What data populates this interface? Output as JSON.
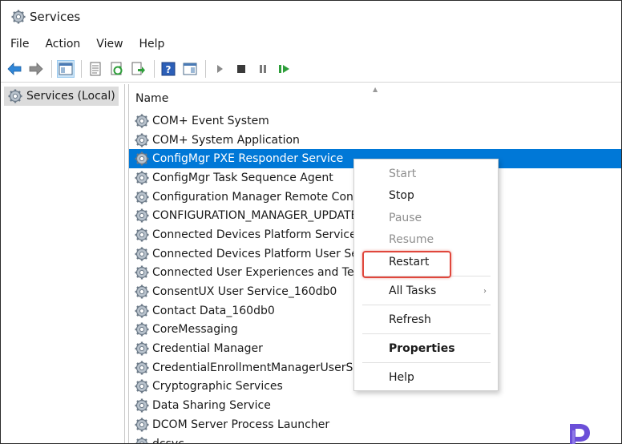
{
  "window": {
    "title": "Services"
  },
  "menu": [
    "File",
    "Action",
    "View",
    "Help"
  ],
  "tree": {
    "root_label": "Services (Local)"
  },
  "list": {
    "column_name": "Name",
    "rows": [
      "COM+ Event System",
      "COM+ System Application",
      "ConfigMgr PXE Responder Service",
      "ConfigMgr Task Sequence Agent",
      "Configuration Manager Remote Contro",
      "CONFIGURATION_MANAGER_UPDATE",
      "Connected Devices Platform Service",
      "Connected Devices Platform User Servic",
      "Connected User Experiences and Teleme",
      "ConsentUX User Service_160db0",
      "Contact Data_160db0",
      "CoreMessaging",
      "Credential Manager",
      "CredentialEnrollmentManagerUserSvc_",
      "Cryptographic Services",
      "Data Sharing Service",
      "DCOM Server Process Launcher",
      "dcsvc"
    ],
    "selected_index": 2
  },
  "context_menu": {
    "start": "Start",
    "stop": "Stop",
    "pause": "Pause",
    "resume": "Resume",
    "restart": "Restart",
    "all_tasks": "All Tasks",
    "refresh": "Refresh",
    "properties": "Properties",
    "help": "Help"
  },
  "colors": {
    "selection": "#0078d7",
    "highlight_box": "#e0473c",
    "logo": "#6b4fd8"
  },
  "icons": {
    "app": "gear-icon",
    "back": "back-arrow-icon",
    "forward": "forward-arrow-icon",
    "play": "play-icon",
    "stop": "stop-icon",
    "pause": "pause-icon",
    "restart": "restart-icon"
  }
}
